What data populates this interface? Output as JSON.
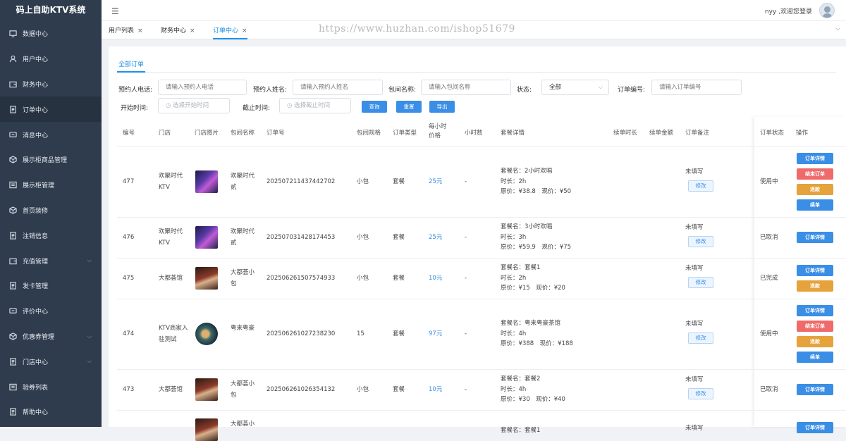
{
  "app": {
    "title": "码上自助KTV系统"
  },
  "sidebar": {
    "items": [
      {
        "label": "数据中心",
        "icon": "monitor-icon"
      },
      {
        "label": "用户中心",
        "icon": "user-icon"
      },
      {
        "label": "财务中心",
        "icon": "wallet-icon"
      },
      {
        "label": "订单中心",
        "icon": "document-icon"
      },
      {
        "label": "消息中心",
        "icon": "message-icon"
      },
      {
        "label": "展示柜商品管理",
        "icon": "box-icon"
      },
      {
        "label": "展示柜管理",
        "icon": "list-icon"
      },
      {
        "label": "首页装修",
        "icon": "box-icon"
      },
      {
        "label": "注销信息",
        "icon": "document-icon"
      },
      {
        "label": "充值管理",
        "icon": "wallet-icon"
      },
      {
        "label": "发卡管理",
        "icon": "document-icon"
      },
      {
        "label": "评价中心",
        "icon": "message-icon"
      },
      {
        "label": "优惠券管理",
        "icon": "box-icon"
      },
      {
        "label": "门店中心",
        "icon": "document-icon"
      },
      {
        "label": "验券列表",
        "icon": "list-icon"
      },
      {
        "label": "帮助中心",
        "icon": "document-icon"
      }
    ]
  },
  "header": {
    "user": "nyy ,欢迎您登录"
  },
  "tabs": [
    {
      "label": "用户列表",
      "close": "×"
    },
    {
      "label": "财务中心",
      "close": "×"
    },
    {
      "label": "订单中心",
      "close": "×"
    }
  ],
  "watermark": "https://www.huzhan.com/ishop51679",
  "subtab": "全部订单",
  "filters": {
    "phone_label": "预约人电话:",
    "phone_placeholder": "请输入预约人电话",
    "name_label": "预约人姓名:",
    "name_placeholder": "请输入预约人姓名",
    "room_label": "包间名称:",
    "room_placeholder": "请输入包间名称",
    "status_label": "状态:",
    "status_value": "全部",
    "order_label": "订单编号:",
    "order_placeholder": "请输入订单编号",
    "start_label": "开始时间:",
    "start_placeholder": "选择开始时间",
    "end_label": "截止时间:",
    "end_placeholder": "选择截止时间",
    "search": "查询",
    "reset": "重置",
    "export": "导出"
  },
  "columns": [
    "编号",
    "门店",
    "门店图片",
    "包间名称",
    "订单号",
    "包间规格",
    "订单类型",
    "每小时价格",
    "小时数",
    "套餐详情",
    "续单时长",
    "续单金额",
    "订单备注",
    "订单状态",
    "操作"
  ],
  "actions": {
    "detail": "订单详情",
    "end": "结束订单",
    "refund": "退款",
    "renew": "续单",
    "modify": "修改"
  },
  "rows": [
    {
      "id": "477",
      "store": "欢聚时代KTV",
      "room": "欢聚时代贰",
      "order_no": "20250721143744270​2",
      "spec": "小包",
      "type": "套餐",
      "price": "25元",
      "hours": "-",
      "pkg_name": "套餐名：2小时欢唱",
      "pkg_dur": "时长：2h",
      "pkg_price": "原价：¥38.8　现价：¥50",
      "note": "未填写",
      "status": "使用中"
    },
    {
      "id": "476",
      "store": "欢聚时代KTV",
      "room": "欢聚时代贰",
      "order_no": "202507031428174453",
      "spec": "小包",
      "type": "套餐",
      "price": "25元",
      "hours": "-",
      "pkg_name": "套餐名：3小时欢唱",
      "pkg_dur": "时长：3h",
      "pkg_price": "原价：¥59.9　现价：¥75",
      "note": "未填写",
      "status": "已取消"
    },
    {
      "id": "475",
      "store": "大都荟馆",
      "room": "大都荟小包",
      "order_no": "202506261507574933",
      "spec": "小包",
      "type": "套餐",
      "price": "10元",
      "hours": "-",
      "pkg_name": "套餐名：套餐1",
      "pkg_dur": "时长：2h",
      "pkg_price": "原价：¥15　现价：¥20",
      "note": "未填写",
      "status": "已完成"
    },
    {
      "id": "474",
      "store": "KTV商家入驻测试",
      "room": "粤来粤豪",
      "order_no": "202506261027238230",
      "spec": "15",
      "type": "套餐",
      "price": "97元",
      "hours": "-",
      "pkg_name": "套餐名：粤来粤豪茶馆",
      "pkg_dur": "时长：4h",
      "pkg_price": "原价：¥388　现价：¥188",
      "note": "未填写",
      "status": "使用中"
    },
    {
      "id": "473",
      "store": "大都荟馆",
      "room": "大都荟小包",
      "order_no": "202506261026354132",
      "spec": "小包",
      "type": "套餐",
      "price": "10元",
      "hours": "-",
      "pkg_name": "套餐名：套餐2",
      "pkg_dur": "时长：4h",
      "pkg_price": "原价：¥30　现价：¥40",
      "note": "未填写",
      "status": "已取消"
    },
    {
      "room": "大都荟小",
      "pkg_name": "套餐名：套餐1",
      "note": "未填写"
    }
  ]
}
